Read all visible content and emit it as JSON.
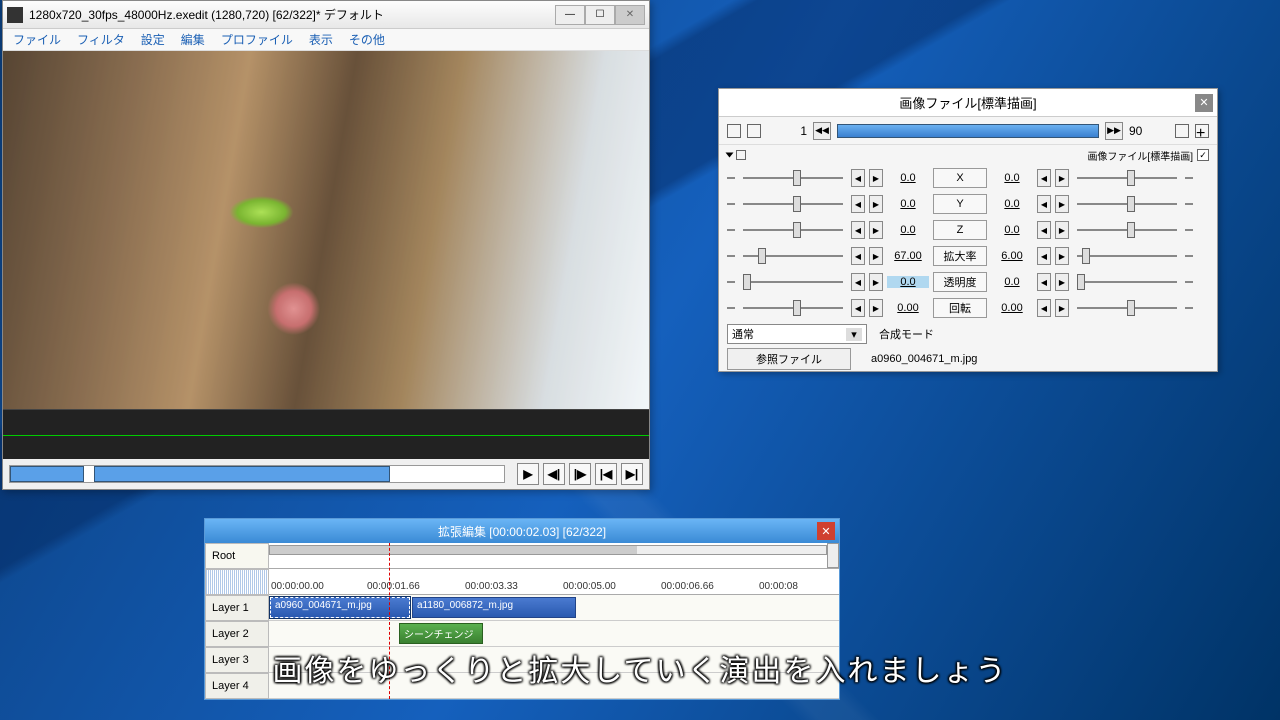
{
  "preview": {
    "title": "1280x720_30fps_48000Hz.exedit (1280,720)  [62/322]* デフォルト",
    "menus": [
      "ファイル",
      "フィルタ",
      "設定",
      "編集",
      "プロファイル",
      "表示",
      "その他"
    ]
  },
  "props": {
    "title": "画像ファイル[標準描画]",
    "frame_start": "1",
    "frame_end": "90",
    "sub_label": "画像ファイル[標準描画]",
    "params": [
      {
        "l": "0.0",
        "name": "X",
        "r": "0.0",
        "lpos": 50,
        "rpos": 50
      },
      {
        "l": "0.0",
        "name": "Y",
        "r": "0.0",
        "lpos": 50,
        "rpos": 50
      },
      {
        "l": "0.0",
        "name": "Z",
        "r": "0.0",
        "lpos": 50,
        "rpos": 50
      },
      {
        "l": "67.00",
        "name": "拡大率",
        "r": "6.00",
        "lpos": 15,
        "rpos": 5
      },
      {
        "l": "0.0",
        "name": "透明度",
        "r": "0.0",
        "lpos": 0,
        "rpos": 0,
        "hl": true
      },
      {
        "l": "0.00",
        "name": "回転",
        "r": "0.00",
        "lpos": 50,
        "rpos": 50
      }
    ],
    "blend_mode": "通常",
    "blend_label": "合成モード",
    "file_btn": "参照ファイル",
    "file_name": "a0960_004671_m.jpg"
  },
  "timeline": {
    "title": "拡張編集 [00:00:02.03] [62/322]",
    "root": "Root",
    "layers": [
      "Layer 1",
      "Layer 2",
      "Layer 3",
      "Layer 4"
    ],
    "times": [
      "00:00:00.00",
      "00:00:01.66",
      "00:00:03.33",
      "00:00:05.00",
      "00:00:06.66",
      "00:00:08"
    ],
    "clips": {
      "c1": "a0960_004671_m.jpg",
      "c2": "a1180_006872_m.jpg",
      "c3": "シーンチェンジ"
    }
  },
  "subtitle": "画像をゆっくりと拡大していく演出を入れましょう"
}
